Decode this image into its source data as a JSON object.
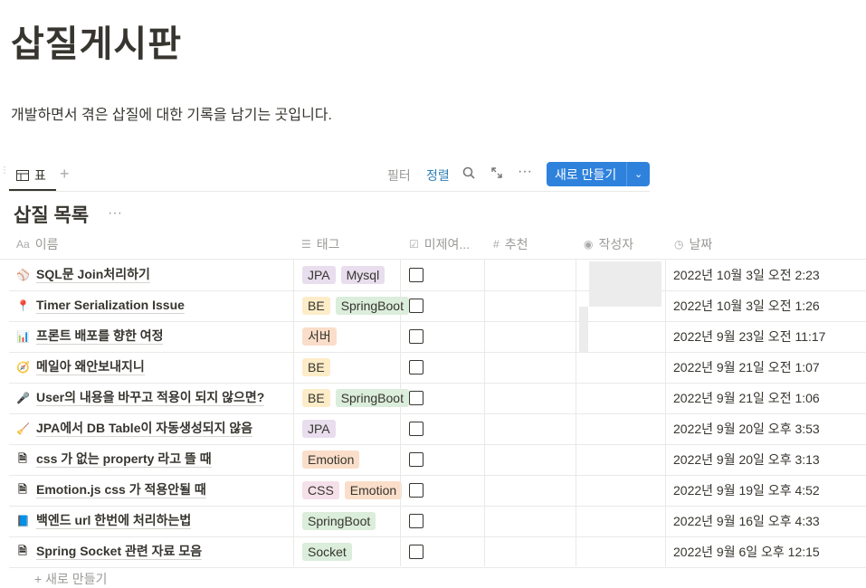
{
  "page": {
    "title": "삽질게시판",
    "description": "개발하면서 겪은 삽질에 대한 기록을 남기는 곳입니다."
  },
  "view": {
    "tab_icon": "table-icon",
    "tab_label": "표",
    "add_view": "+",
    "filter": "필터",
    "sort": "정렬",
    "new_button": "새로 만들기"
  },
  "database": {
    "title": "삽질 목록",
    "more": "···"
  },
  "columns": {
    "name": "이름",
    "name_icon": "Aa",
    "tags": "태그",
    "done": "미제여...",
    "recommend": "추천",
    "author": "작성자",
    "date": "날짜"
  },
  "tag_colors": {
    "JPA": "#e8deee",
    "Mysql": "#e8deee",
    "BE": "#fdecc8",
    "SpringBoot": "#dbeddb",
    "서버": "#fadec9",
    "Emotion": "#fadec9",
    "CSS": "#f5e0e9",
    "Socket": "#dbeddb"
  },
  "rows": [
    {
      "icon": "baseball-icon",
      "glyph": "⚾",
      "name": "SQL문 Join처리하기",
      "tags": [
        "JPA",
        "Mysql"
      ],
      "date": "2022년 10월 3일 오전 2:23"
    },
    {
      "icon": "pin-icon",
      "glyph": "📍",
      "name": "Timer Serialization Issue",
      "tags": [
        "BE",
        "SpringBoot"
      ],
      "date": "2022년 10월 3일 오전 1:26"
    },
    {
      "icon": "chart-icon",
      "glyph": "📊",
      "name": "프론트 배포를 향한 여정",
      "tags": [
        "서버"
      ],
      "date": "2022년 9월 23일 오전 11:17"
    },
    {
      "icon": "compass-icon",
      "glyph": "🧭",
      "name": "메일아 왜안보내지니",
      "tags": [
        "BE"
      ],
      "date": "2022년 9월 21일 오전 1:07"
    },
    {
      "icon": "microphone-icon",
      "glyph": "🎤",
      "name": "User의 내용을 바꾸고 적용이 되지 않으면?",
      "tags": [
        "BE",
        "SpringBoot"
      ],
      "date": "2022년 9월 21일 오전 1:06"
    },
    {
      "icon": "broom-icon",
      "glyph": "🧹",
      "name": "JPA에서 DB Table이 자동생성되지 않음",
      "tags": [
        "JPA"
      ],
      "date": "2022년 9월 20일 오후 3:53"
    },
    {
      "icon": "page-icon",
      "glyph": "🗎",
      "name": "css 가 없는 property 라고 뜰 때",
      "tags": [
        "Emotion"
      ],
      "date": "2022년 9월 20일 오후 3:13"
    },
    {
      "icon": "page-icon",
      "glyph": "🗎",
      "name": "Emotion.js css 가 적용안될 때",
      "tags": [
        "CSS",
        "Emotion"
      ],
      "date": "2022년 9월 19일 오후 4:52"
    },
    {
      "icon": "book-icon",
      "glyph": "📘",
      "name": "백엔드 url 한번에 처리하는법",
      "tags": [
        "SpringBoot"
      ],
      "date": "2022년 9월 16일 오후 4:33"
    },
    {
      "icon": "page-icon",
      "glyph": "🗎",
      "name": "Spring Socket 관련 자료 모음",
      "tags": [
        "Socket"
      ],
      "date": "2022년 9월 6일 오후 12:15"
    }
  ],
  "footer": "+ 새로 만들기"
}
